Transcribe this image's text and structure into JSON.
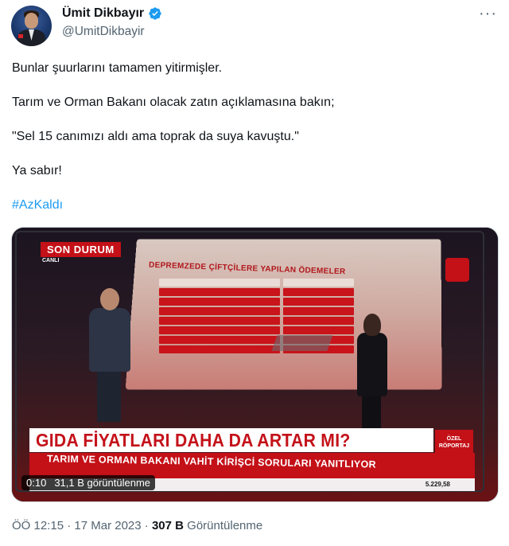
{
  "tweet": {
    "display_name": "Ümit Dikbayır",
    "handle": "@UmitDikbayir",
    "lines": [
      "Bunlar şuurlarını tamamen yitirmişler.",
      "Tarım ve Orman Bakanı olacak zatın açıklamasına bakın;",
      "\"Sel 15 canımızı aldı ama toprak da suya kavuştu.\"",
      "Ya sabır!"
    ],
    "hashtag": "#AzKaldı",
    "time": "ÖÖ 12:15",
    "date": "17 Mar 2023",
    "views_count": "307 B",
    "views_label": "Görüntülenme",
    "separator": "·"
  },
  "video": {
    "duration": "0:10",
    "views": "31,1 B görüntülenme",
    "badge": "SON DURUM",
    "live": "CANLI",
    "board_title": "DEPREMZEDE ÇİFTÇİLERE YAPILAN ÖDEMELER",
    "headline": "GIDA FİYATLARI DAHA DA ARTAR MI?",
    "subheadline": "TARIM VE ORMAN BAKANI VAHİT KİRİŞCİ SORULARI YANITLIYOR",
    "special": "ÖZEL RÖPORTAJ",
    "ticker_value": "5.229,58"
  },
  "colors": {
    "accent": "#1d9bf0",
    "verified": "#1d9bf0",
    "muted": "#536471",
    "tv_red": "#c41017"
  },
  "icons": [
    "verified-badge-icon",
    "more-icon"
  ]
}
